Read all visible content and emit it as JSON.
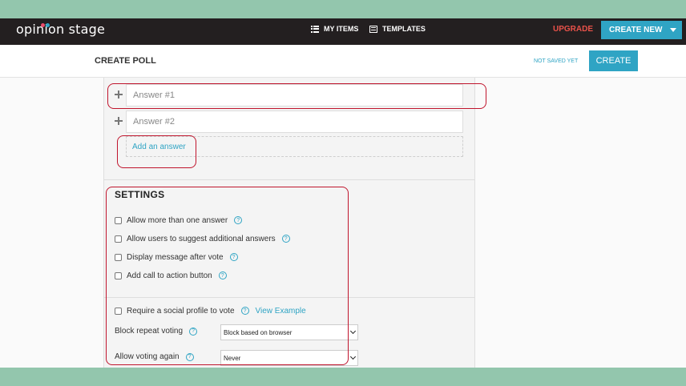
{
  "header": {
    "logo": "opinion stage",
    "nav": [
      {
        "label": "MY ITEMS",
        "icon": "list-icon"
      },
      {
        "label": "TEMPLATES",
        "icon": "templates-icon"
      }
    ],
    "upgrade_label": "UPGRADE",
    "create_new_label": "CREATE NEW"
  },
  "subheader": {
    "title": "CREATE POLL",
    "status": "NOT SAVED YET",
    "create_label": "CREATE"
  },
  "answers": {
    "items": [
      {
        "placeholder": "Answer #1"
      },
      {
        "placeholder": "Answer #2"
      }
    ],
    "add_label": "Add an answer"
  },
  "settings": {
    "title": "SETTINGS",
    "options": [
      {
        "label": "Allow more than one answer",
        "checked": false
      },
      {
        "label": "Allow users to suggest additional answers",
        "checked": false
      },
      {
        "label": "Display message after vote",
        "checked": false
      },
      {
        "label": "Add call to action button",
        "checked": false
      }
    ],
    "social": {
      "label": "Require a social profile to vote",
      "link": "View Example",
      "checked": false
    },
    "block_repeat": {
      "label": "Block repeat voting",
      "value": "Block based on browser"
    },
    "allow_again": {
      "label": "Allow voting again",
      "value": "Never"
    },
    "help_glyph": "?"
  },
  "colors": {
    "accent": "#2fa4c4",
    "upgrade": "#e9524a",
    "topbar": "#231f20",
    "frame": "#93c6ad",
    "highlight": "#c0152d"
  }
}
